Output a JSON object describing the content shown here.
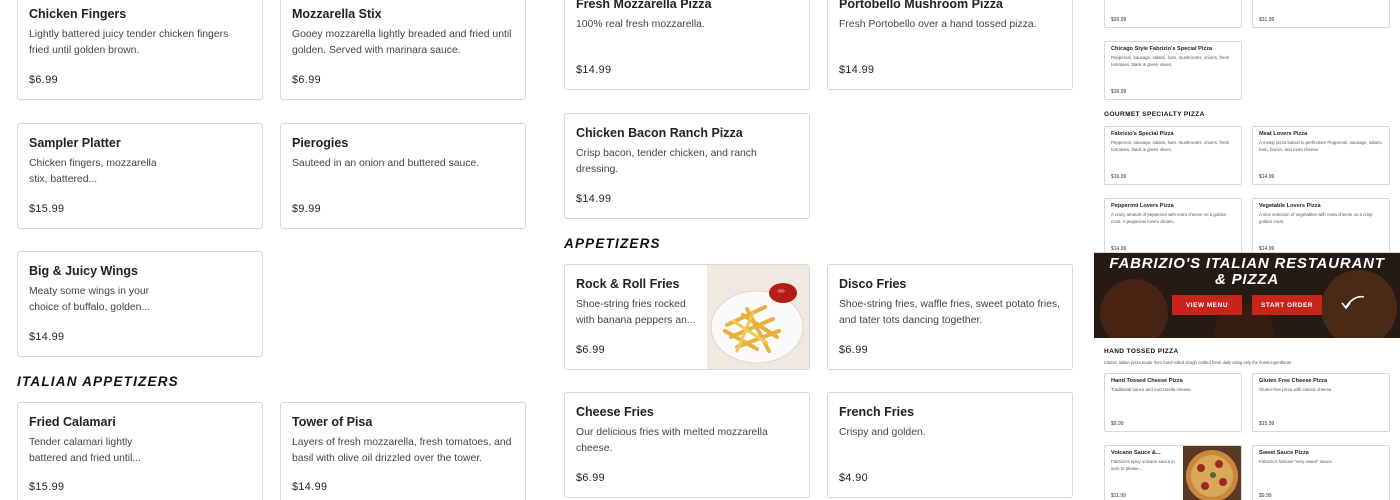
{
  "col1": [
    {
      "title": "Chicken Fingers",
      "desc": "Lightly battered juicy tender chicken fingers fried until golden brown.",
      "price": "$6.99"
    },
    {
      "title": "Sampler Platter",
      "desc": "Chicken fingers, mozzarella stix, battered...",
      "price": "$15.99"
    },
    {
      "title": "Big & Juicy Wings",
      "desc": "Meaty some wings in your choice of buffalo, golden...",
      "price": "$14.99"
    }
  ],
  "col2": [
    {
      "title": "Mozzarella Stix",
      "desc": "Gooey mozzarella lightly breaded and fried until golden. Served with marinara sauce.",
      "price": "$6.99"
    },
    {
      "title": "Pierogies",
      "desc": "Sauteed in an onion and buttered sauce.",
      "price": "$9.99"
    }
  ],
  "italian_appetizers": {
    "heading": "Italian Appetizers",
    "items": [
      {
        "title": "Fried Calamari",
        "desc": "Tender calamari lightly battered and fried until...",
        "price": "$15.99"
      },
      {
        "title": "Tower of Pisa",
        "desc": "Layers of fresh mozzarella, fresh tomatoes, and basil with olive oil drizzled over the tower.",
        "price": "$14.99"
      }
    ]
  },
  "col3_top": [
    {
      "title": "Fresh Mozzarella Pizza",
      "desc": "100% real fresh mozzarella.",
      "price": "$14.99"
    },
    {
      "title": "Chicken Bacon Ranch Pizza",
      "desc": "Crisp bacon, tender chicken, and ranch dressing.",
      "price": "$14.99"
    }
  ],
  "col4_top": [
    {
      "title": "Portobello Mushroom Pizza",
      "desc": "Fresh Portobello over a hand tossed pizza.",
      "price": "$14.99"
    }
  ],
  "appetizers": {
    "heading": "Appetizers",
    "items": [
      {
        "title": "Rock & Roll Fries",
        "desc": "Shoe-string fries rocked with banana peppers an...",
        "price": "$6.99"
      },
      {
        "title": "Disco Fries",
        "desc": "Shoe-string fries, waffle fries, sweet potato fries, and tater tots dancing together.",
        "price": "$6.99"
      },
      {
        "title": "Cheese Fries",
        "desc": "Our delicious fries with melted mozzarella cheese.",
        "price": "$6.99"
      },
      {
        "title": "French Fries",
        "desc": "Crispy and golden.",
        "price": "$4.90"
      }
    ]
  },
  "mini": {
    "top_prices": [
      "$26.99",
      "$31.99"
    ],
    "chicago": {
      "title": "Chicago Style Fabrizio's Special Pizza",
      "desc": "Pepperoni, sausage, salami, ham, mushrooms, onions, fresh tomatoes, black & green olives,",
      "price": "$36.99"
    },
    "gourmet_heading": "Gourmet Specialty Pizza",
    "gourmet": [
      {
        "title": "Fabrizio's Special Pizza",
        "desc": "Pepperoni, sausage, salami, ham, mushrooms, onions, fresh tomatoes, black & green olives,",
        "price": "$16.99"
      },
      {
        "title": "Meat Lovers Pizza",
        "desc": "A meaty pizza baked to perfection! Pepperoni, sausage, salami, ham, bacon, and extra cheese.",
        "price": "$14.99"
      },
      {
        "title": "Pepperoni Lovers Pizza",
        "desc": "A crazy amount of pepperoni with extra cheese on a golden crust. A pepperoni lovers dream.",
        "price": "$14.99"
      },
      {
        "title": "Vegetable Lovers Pizza",
        "desc": "A nice selection of vegetables with extra cheese on a crisp golden crust.",
        "price": "$14.99"
      }
    ],
    "hero_title": "Fabrizio's Italian Restaurant & Pizza",
    "view_menu": "VIEW MENU",
    "start_order": "START ORDER",
    "hand_heading": "Hand Tossed Pizza",
    "hand_sub": "Classic Italian pizza made from hand-rolled dough crafted fresh daily using only the finest ingredients.",
    "hand": [
      {
        "title": "Hand Tossed Cheese Pizza",
        "desc": "Traditional sauce and mozzarella cheese.",
        "price": "$9.99"
      },
      {
        "title": "Gluten Free Cheese Pizza",
        "desc": "Gluten-free pizza with classic cheese.",
        "price": "$15.99"
      },
      {
        "title": "Volcano Sauce &...",
        "desc": "Fabrizio's spicy volcano sauce in sure to please...",
        "price": "$11.99"
      },
      {
        "title": "Sweet Sauce Pizza",
        "desc": "Fabrizio's famous \"very sweet\" sauce.",
        "price": "$9.99"
      }
    ]
  }
}
